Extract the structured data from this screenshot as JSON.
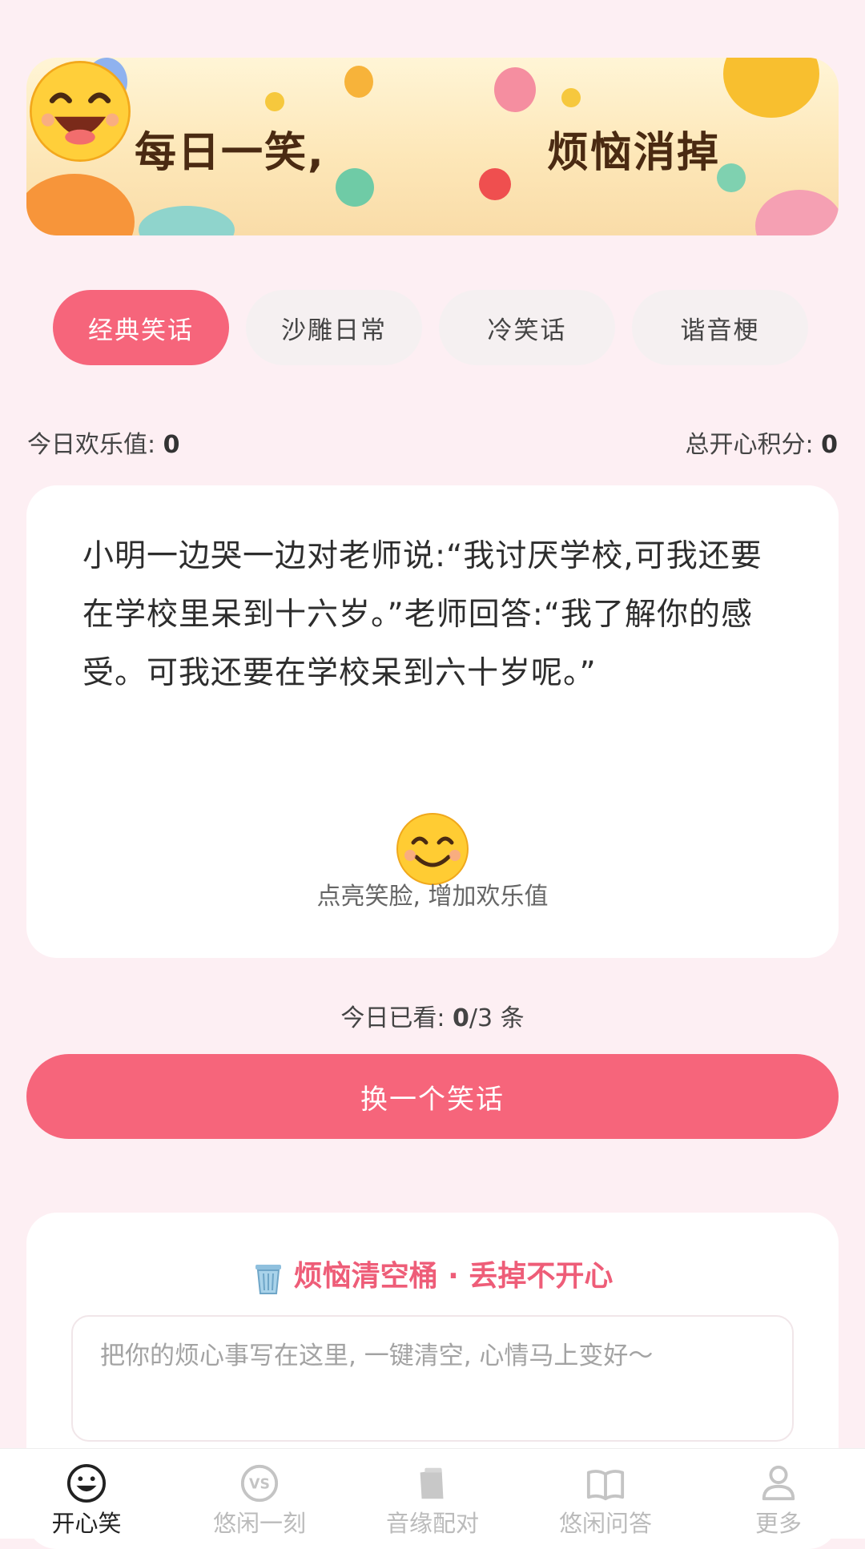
{
  "banner": {
    "left_text": "每日一笑,",
    "right_text": "烦恼消掉"
  },
  "tabs": [
    {
      "label": "经典笑话",
      "active": true
    },
    {
      "label": "沙雕日常",
      "active": false
    },
    {
      "label": "冷笑话",
      "active": false
    },
    {
      "label": "谐音梗",
      "active": false
    }
  ],
  "stats": {
    "joy_label": "今日欢乐值:",
    "joy_value": "0",
    "score_label": "总开心积分:",
    "score_value": "0"
  },
  "joke": {
    "text": "小明一边哭一边对老师说:“我讨厌学校,可我还要在学校里呆到十六岁。”老师回答:“我了解你的感受。可我还要在学校呆到六十岁呢。”",
    "hint": "点亮笑脸, 增加欢乐值"
  },
  "watched": {
    "label": "今日已看:",
    "count": "0",
    "total": "/3 条"
  },
  "next_button": "换一个笑话",
  "trash": {
    "title": "烦恼清空桶 · 丢掉不开心",
    "placeholder": "把你的烦心事写在这里, 一键清空, 心情马上变好～"
  },
  "nav": [
    {
      "label": "开心笑",
      "icon": "smile-icon",
      "active": true
    },
    {
      "label": "悠闲一刻",
      "icon": "vs-icon",
      "active": false
    },
    {
      "label": "音缘配对",
      "icon": "cup-icon",
      "active": false
    },
    {
      "label": "悠闲问答",
      "icon": "book-icon",
      "active": false
    },
    {
      "label": "更多",
      "icon": "person-icon",
      "active": false
    }
  ],
  "colors": {
    "accent": "#f6657b",
    "background": "#fdeff3",
    "trash_title": "#ee5d78"
  }
}
